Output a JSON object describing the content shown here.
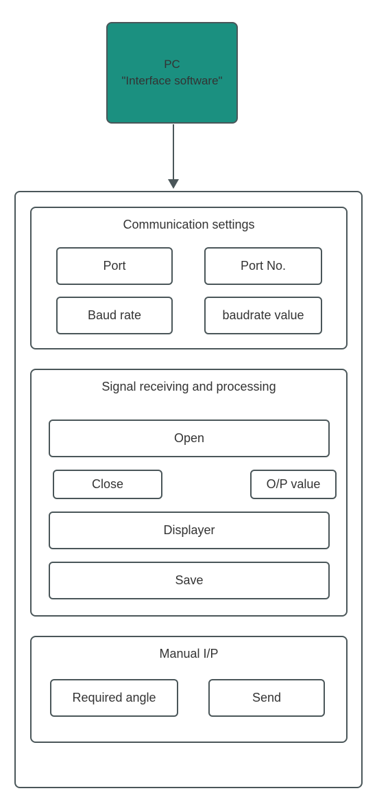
{
  "pc": {
    "line1": "PC",
    "line2": "\"Interface software\""
  },
  "comm": {
    "title": "Communication settings",
    "port": "Port",
    "portno": "Port No.",
    "baud": "Baud rate",
    "baudval": "baudrate value"
  },
  "signal": {
    "title": "Signal receiving and processing",
    "open": "Open",
    "close": "Close",
    "op": "O/P value",
    "displayer": "Displayer",
    "save": "Save"
  },
  "manual": {
    "title": "Manual I/P",
    "angle": "Required angle",
    "send": "Send"
  }
}
